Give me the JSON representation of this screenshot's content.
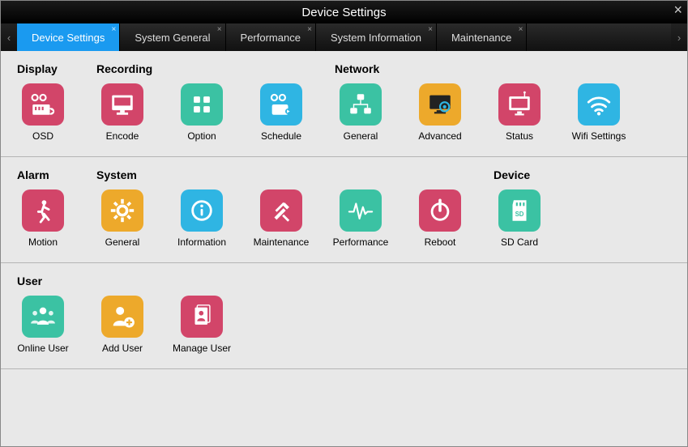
{
  "window": {
    "title": "Device Settings"
  },
  "tabs": [
    {
      "label": "Device Settings",
      "active": true
    },
    {
      "label": "System General",
      "active": false
    },
    {
      "label": "Performance",
      "active": false
    },
    {
      "label": "System Information",
      "active": false
    },
    {
      "label": "Maintenance",
      "active": false
    }
  ],
  "rows": [
    {
      "groups": [
        {
          "label": "Display",
          "items": [
            {
              "label": "OSD",
              "color": "pink",
              "icon": "osd"
            }
          ]
        },
        {
          "label": "Recording",
          "items": [
            {
              "label": "Encode",
              "color": "pink",
              "icon": "encode"
            },
            {
              "label": "Option",
              "color": "teal",
              "icon": "option"
            },
            {
              "label": "Schedule",
              "color": "blue",
              "icon": "schedule"
            }
          ]
        },
        {
          "label": "Network",
          "items": [
            {
              "label": "General",
              "color": "teal",
              "icon": "net-general"
            },
            {
              "label": "Advanced",
              "color": "orange",
              "icon": "net-advanced"
            },
            {
              "label": "Status",
              "color": "pink",
              "icon": "status"
            },
            {
              "label": "Wifi Settings",
              "color": "blue",
              "icon": "wifi"
            }
          ]
        }
      ]
    },
    {
      "groups": [
        {
          "label": "Alarm",
          "items": [
            {
              "label": "Motion",
              "color": "pink",
              "icon": "motion"
            }
          ]
        },
        {
          "label": "System",
          "items": [
            {
              "label": "General",
              "color": "orange",
              "icon": "gear"
            },
            {
              "label": "Information",
              "color": "blue",
              "icon": "info"
            },
            {
              "label": "Maintenance",
              "color": "pink",
              "icon": "tools"
            },
            {
              "label": "Performance",
              "color": "teal",
              "icon": "pulse"
            },
            {
              "label": "Reboot",
              "color": "pink",
              "icon": "power"
            }
          ]
        },
        {
          "label": "Device",
          "items": [
            {
              "label": "SD Card",
              "color": "teal",
              "icon": "sd"
            }
          ]
        }
      ]
    },
    {
      "groups": [
        {
          "label": "User",
          "items": [
            {
              "label": "Online User",
              "color": "teal",
              "icon": "users"
            },
            {
              "label": "Add User",
              "color": "orange",
              "icon": "add-user"
            },
            {
              "label": "Manage User",
              "color": "pink",
              "icon": "manage-user"
            }
          ]
        }
      ]
    }
  ]
}
